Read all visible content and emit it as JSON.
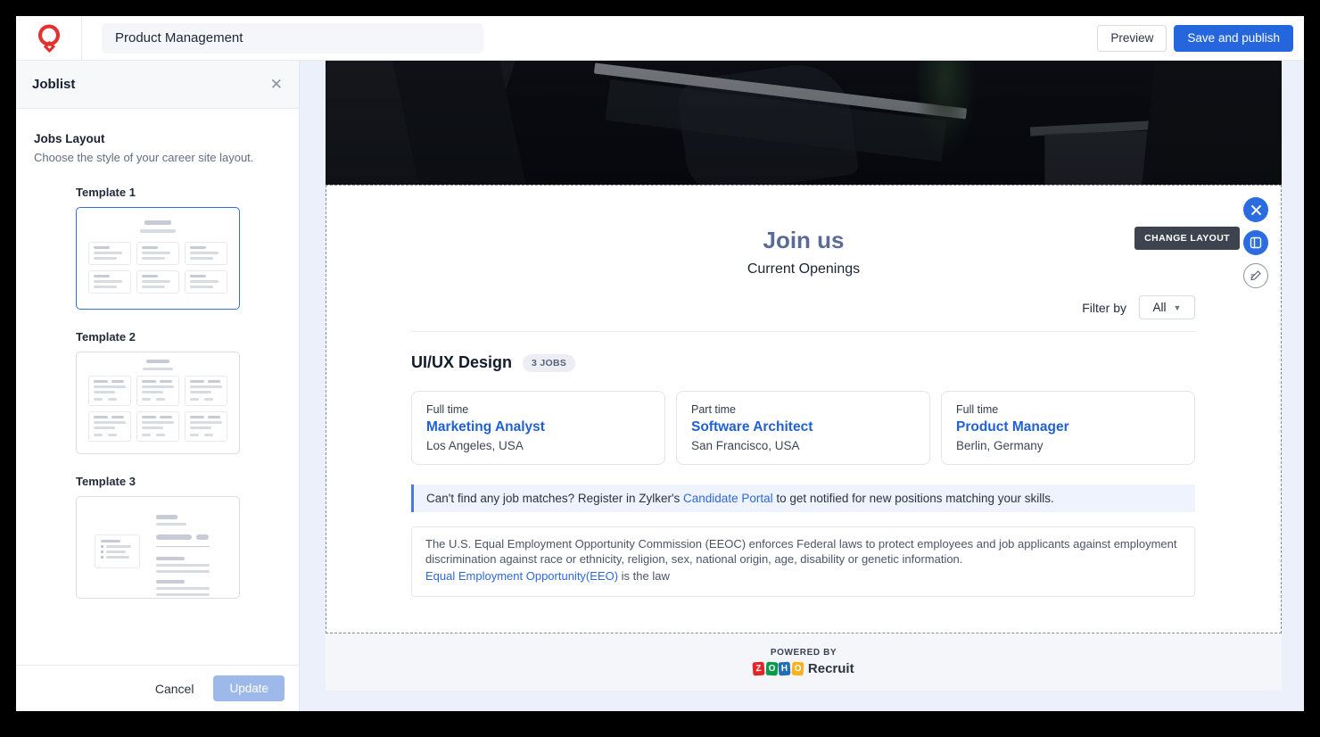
{
  "topbar": {
    "title_value": "Product Management",
    "preview_label": "Preview",
    "save_label": "Save and publish"
  },
  "sidebar": {
    "title": "Joblist",
    "section_title": "Jobs Layout",
    "section_description": "Choose the style of your career site layout.",
    "templates": [
      {
        "label": "Template 1",
        "selected": true
      },
      {
        "label": "Template 2",
        "selected": false
      },
      {
        "label": "Template 3",
        "selected": false
      }
    ],
    "cancel_label": "Cancel",
    "update_label": "Update"
  },
  "canvas": {
    "change_layout_tooltip": "CHANGE LAYOUT",
    "joinus": {
      "title": "Join us",
      "subtitle": "Current Openings"
    },
    "filter": {
      "label": "Filter by",
      "value": "All"
    },
    "section": {
      "title": "UI/UX Design",
      "badge": "3 JOBS"
    },
    "jobs": [
      {
        "type": "Full time",
        "title": "Marketing Analyst",
        "location": "Los Angeles, USA"
      },
      {
        "type": "Part time",
        "title": "Software Architect",
        "location": "San Francisco, USA"
      },
      {
        "type": "Full time",
        "title": "Product Manager",
        "location": "Berlin, Germany"
      }
    ],
    "portal_note": {
      "pre": "Can't find any job matches? Register in Zylker's ",
      "link": "Candidate Portal",
      "post": " to get notified for new positions matching your skills."
    },
    "eeoc": {
      "text": "The U.S. Equal Employment Opportunity Commission (EEOC) enforces Federal laws to protect employees and job applicants against employment discrimination against race or ethnicity, religion, sex, national origin, age, disability or genetic information.",
      "link": "Equal Employment Opportunity(EEO)",
      "suffix": " is the law"
    },
    "footer": {
      "powered_by": "POWERED BY",
      "zoho_letters": [
        "Z",
        "O",
        "H",
        "O"
      ],
      "brand": "Recruit"
    }
  },
  "colors": {
    "primary_blue": "#2666dd",
    "link_blue": "#2061d5",
    "joinus_heading": "#5a6b95",
    "selected_template_border": "#2f6fe0",
    "update_disabled": "#9db9ea",
    "banner_bg": "#eef3fd",
    "zoho_red": "#e42527",
    "zoho_green": "#089949",
    "zoho_blue": "#226db4",
    "zoho_orange": "#f9b21d"
  }
}
